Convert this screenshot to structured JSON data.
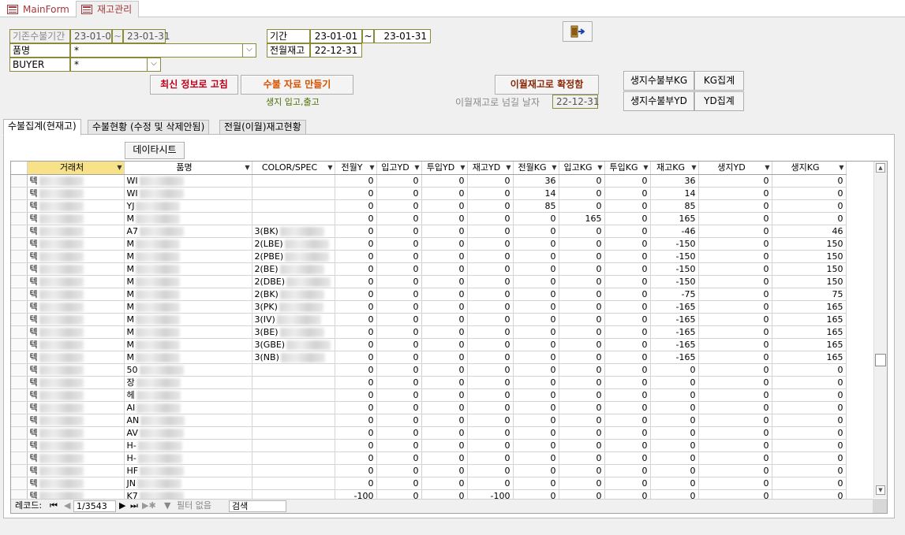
{
  "doc_tabs": [
    "MainForm",
    "재고관리"
  ],
  "filters": {
    "existing_period_label": "기존수불기간",
    "existing_from": "23-01-01",
    "tilde": "~",
    "existing_to": "23-01-31",
    "item_label": "품명",
    "item_value": "*",
    "buyer_label": "BUYER",
    "buyer_value": "*",
    "period_label": "기간",
    "period_from": "23-01-01",
    "period_to": "23-01-31",
    "prev_stock_label": "전월재고",
    "prev_stock_date": "22-12-31"
  },
  "buttons": {
    "refresh": "최신 정보로 고침",
    "make_data": "수불 자료 만들기",
    "make_data_note": "생지 입고,출고",
    "carry_over": "이월재고로 확정함",
    "carry_over_label": "이월재고로 넘길 날자",
    "carry_over_date": "22-12-31",
    "ledger_kg": "생지수불부KG",
    "sum_kg": "KG집계",
    "ledger_yd": "생지수불부YD",
    "sum_yd": "YD집계",
    "datasheet": "데이타시트"
  },
  "inner_tabs": [
    "수불집계(현재고)",
    "수불현황 (수정 및 삭제안됨)",
    "전월(이월)재고현황"
  ],
  "grid": {
    "columns": [
      "거래처",
      "품명",
      "COLOR/SPEC",
      "전월Y",
      "입고YD",
      "투입YD",
      "재고YD",
      "전월KG",
      "입고KG",
      "투입KG",
      "재고KG",
      "생지YD",
      "생지KG"
    ],
    "rows": [
      [
        "텍",
        "WI",
        "",
        "0",
        "0",
        "0",
        "0",
        "36",
        "0",
        "0",
        "36",
        "0",
        "0"
      ],
      [
        "텍",
        "WI",
        "",
        "0",
        "0",
        "0",
        "0",
        "14",
        "0",
        "0",
        "14",
        "0",
        "0"
      ],
      [
        "텍",
        "YJ",
        "",
        "0",
        "0",
        "0",
        "0",
        "85",
        "0",
        "0",
        "85",
        "0",
        "0"
      ],
      [
        "텍",
        "M",
        "",
        "0",
        "0",
        "0",
        "0",
        "0",
        "165",
        "0",
        "165",
        "0",
        "0"
      ],
      [
        "텍",
        "A7",
        "3(BK)",
        "0",
        "0",
        "0",
        "0",
        "0",
        "0",
        "0",
        "-46",
        "0",
        "46"
      ],
      [
        "텍",
        "M",
        "2(LBE)",
        "0",
        "0",
        "0",
        "0",
        "0",
        "0",
        "0",
        "-150",
        "0",
        "150"
      ],
      [
        "텍",
        "M",
        "2(PBE)",
        "0",
        "0",
        "0",
        "0",
        "0",
        "0",
        "0",
        "-150",
        "0",
        "150"
      ],
      [
        "텍",
        "M",
        "2(BE)",
        "0",
        "0",
        "0",
        "0",
        "0",
        "0",
        "0",
        "-150",
        "0",
        "150"
      ],
      [
        "텍",
        "M",
        "2(DBE)",
        "0",
        "0",
        "0",
        "0",
        "0",
        "0",
        "0",
        "-150",
        "0",
        "150"
      ],
      [
        "텍",
        "M",
        "2(BK)",
        "0",
        "0",
        "0",
        "0",
        "0",
        "0",
        "0",
        "-75",
        "0",
        "75"
      ],
      [
        "텍",
        "M",
        "3(PK)",
        "0",
        "0",
        "0",
        "0",
        "0",
        "0",
        "0",
        "-165",
        "0",
        "165"
      ],
      [
        "텍",
        "M",
        "3(IV)",
        "0",
        "0",
        "0",
        "0",
        "0",
        "0",
        "0",
        "-165",
        "0",
        "165"
      ],
      [
        "텍",
        "M",
        "3(BE)",
        "0",
        "0",
        "0",
        "0",
        "0",
        "0",
        "0",
        "-165",
        "0",
        "165"
      ],
      [
        "텍",
        "M",
        "3(GBE)",
        "0",
        "0",
        "0",
        "0",
        "0",
        "0",
        "0",
        "-165",
        "0",
        "165"
      ],
      [
        "텍",
        "M",
        "3(NB)",
        "0",
        "0",
        "0",
        "0",
        "0",
        "0",
        "0",
        "-165",
        "0",
        "165"
      ],
      [
        "텍",
        "50",
        "",
        "0",
        "0",
        "0",
        "0",
        "0",
        "0",
        "0",
        "0",
        "0",
        "0"
      ],
      [
        "텍",
        "장",
        "",
        "0",
        "0",
        "0",
        "0",
        "0",
        "0",
        "0",
        "0",
        "0",
        "0"
      ],
      [
        "텍",
        "헤",
        "",
        "0",
        "0",
        "0",
        "0",
        "0",
        "0",
        "0",
        "0",
        "0",
        "0"
      ],
      [
        "텍",
        "AI",
        "",
        "0",
        "0",
        "0",
        "0",
        "0",
        "0",
        "0",
        "0",
        "0",
        "0"
      ],
      [
        "텍",
        "AN",
        "",
        "0",
        "0",
        "0",
        "0",
        "0",
        "0",
        "0",
        "0",
        "0",
        "0"
      ],
      [
        "텍",
        "AV",
        "",
        "0",
        "0",
        "0",
        "0",
        "0",
        "0",
        "0",
        "0",
        "0",
        "0"
      ],
      [
        "텍",
        "H-",
        "",
        "0",
        "0",
        "0",
        "0",
        "0",
        "0",
        "0",
        "0",
        "0",
        "0"
      ],
      [
        "텍",
        "H-",
        "",
        "0",
        "0",
        "0",
        "0",
        "0",
        "0",
        "0",
        "0",
        "0",
        "0"
      ],
      [
        "텍",
        "HF",
        "",
        "0",
        "0",
        "0",
        "0",
        "0",
        "0",
        "0",
        "0",
        "0",
        "0"
      ],
      [
        "텍",
        "JN",
        "",
        "0",
        "0",
        "0",
        "0",
        "0",
        "0",
        "0",
        "0",
        "0",
        "0"
      ],
      [
        "텍",
        "K7",
        "",
        "-100",
        "0",
        "0",
        "-100",
        "0",
        "0",
        "0",
        "0",
        "0",
        "0"
      ]
    ]
  },
  "nav": {
    "record_label": "레코드:",
    "record_pos": "1/3543",
    "no_filter": "필터 없음",
    "search": "검색"
  }
}
